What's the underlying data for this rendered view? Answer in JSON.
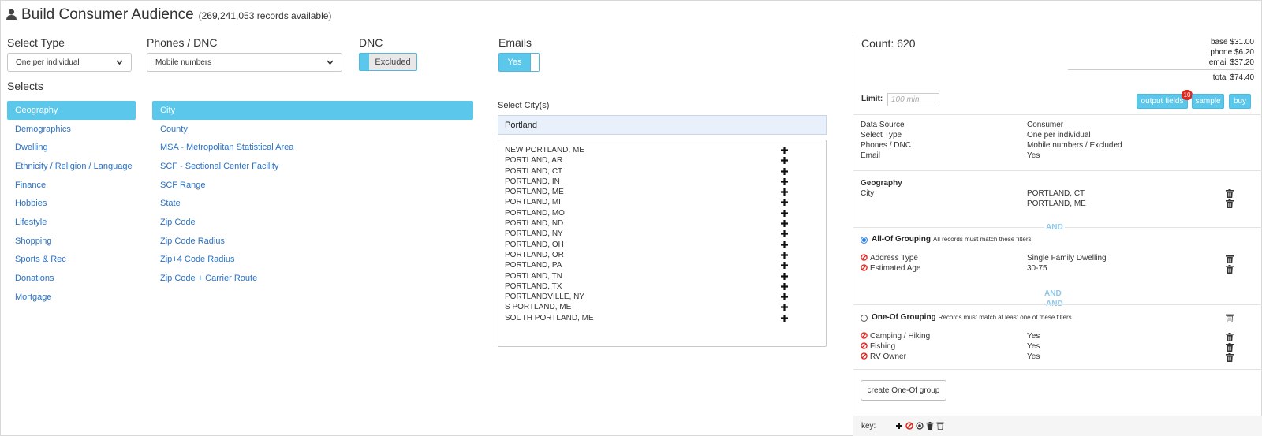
{
  "header": {
    "title": "Build Consumer Audience",
    "records": "(269,241,053 records available)"
  },
  "filters": {
    "select_type": {
      "label": "Select Type",
      "value": "One per individual"
    },
    "phones_dnc": {
      "label": "Phones / DNC",
      "value": "Mobile numbers"
    },
    "dnc": {
      "label": "DNC",
      "value": "Excluded"
    },
    "emails": {
      "label": "Emails",
      "value": "Yes"
    }
  },
  "selects": {
    "label": "Selects",
    "categories": [
      "Geography",
      "Demographics",
      "Dwelling",
      "Ethnicity / Religion / Language",
      "Finance",
      "Hobbies",
      "Lifestyle",
      "Shopping",
      "Sports & Rec",
      "Donations",
      "Mortgage"
    ],
    "active_category": "Geography",
    "geo_options": [
      "City",
      "County",
      "MSA - Metropolitan Statistical Area",
      "SCF - Sectional Center Facility",
      "SCF Range",
      "State",
      "Zip Code",
      "Zip Code Radius",
      "Zip+4 Code Radius",
      "Zip Code + Carrier Route"
    ],
    "active_geo": "City"
  },
  "city_select": {
    "label": "Select City(s)",
    "query": "Portland",
    "results": [
      "NEW PORTLAND, ME",
      "PORTLAND, AR",
      "PORTLAND, CT",
      "PORTLAND, IN",
      "PORTLAND, ME",
      "PORTLAND, MI",
      "PORTLAND, MO",
      "PORTLAND, ND",
      "PORTLAND, NY",
      "PORTLAND, OH",
      "PORTLAND, OR",
      "PORTLAND, PA",
      "PORTLAND, TN",
      "PORTLAND, TX",
      "PORTLANDVILLE, NY",
      "S PORTLAND, ME",
      "SOUTH PORTLAND, ME"
    ]
  },
  "summary": {
    "count": "Count: 620",
    "base": "base $31.00",
    "phone": "phone $6.20",
    "email": "email $37.20",
    "total": "total $74.40",
    "limit_label": "Limit:",
    "limit_placeholder": "100 min",
    "output_fields": "output fields",
    "output_fields_badge": "10",
    "sample": "sample",
    "buy": "buy",
    "meta": [
      {
        "key": "Data Source",
        "value": "Consumer"
      },
      {
        "key": "Select Type",
        "value": "One per individual"
      },
      {
        "key": "Phones / DNC",
        "value": "Mobile numbers / Excluded"
      },
      {
        "key": "Email",
        "value": "Yes"
      }
    ],
    "geography": {
      "title": "Geography",
      "field": "City",
      "values": [
        "PORTLAND, CT",
        "PORTLAND, ME"
      ]
    },
    "and_label": "AND",
    "all_of": {
      "title": "All-Of Grouping",
      "note": "All records must match these filters.",
      "items": [
        {
          "field": "Address Type",
          "value": "Single Family Dwelling"
        },
        {
          "field": "Estimated Age",
          "value": "30-75"
        }
      ]
    },
    "one_of": {
      "title": "One-Of Grouping",
      "note": "Records must match at least one of these filters.",
      "items": [
        {
          "field": "Camping / Hiking",
          "value": "Yes"
        },
        {
          "field": "Fishing",
          "value": "Yes"
        },
        {
          "field": "RV Owner",
          "value": "Yes"
        }
      ]
    },
    "create_group": "create One-Of group",
    "key_label": "key:"
  },
  "colors": {
    "accent": "#5bc7ea",
    "link": "#2a72c5",
    "ban": "#e0261d",
    "and": "#8ec8ea"
  }
}
